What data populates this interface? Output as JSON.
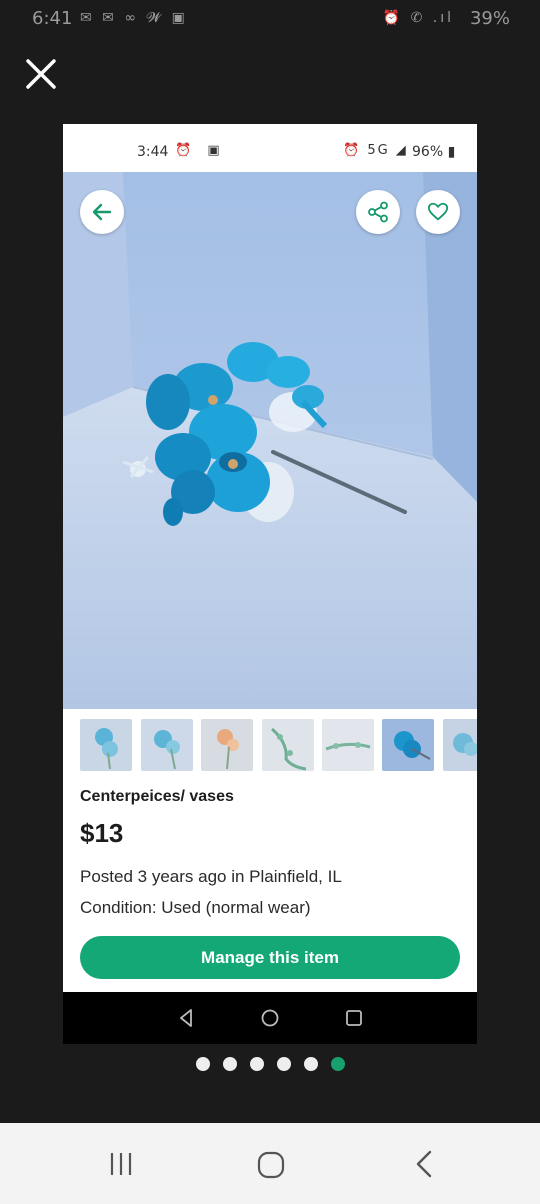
{
  "outer_status": {
    "time": "6:41",
    "left_icons": "✉ ✉ ∞ 𝓦 ▣",
    "right_icons": "⏰ ✆ .ıl",
    "battery": "39%"
  },
  "inner_status": {
    "time": "3:44",
    "left_icons": "⏰ ▣",
    "right_icons": "⏰ 5G ◢",
    "battery": "96% ▮"
  },
  "listing": {
    "title": "Centerpeices/ vases",
    "price": "$13",
    "posted": "Posted 3 years ago in Plainfield, IL",
    "condition": "Condition: Used (normal wear)",
    "manage_label": "Manage this item"
  },
  "thumbnails": [
    {
      "name": "thumb-1",
      "selected": false
    },
    {
      "name": "thumb-2",
      "selected": false
    },
    {
      "name": "thumb-3",
      "selected": false
    },
    {
      "name": "thumb-4",
      "selected": false
    },
    {
      "name": "thumb-5",
      "selected": false
    },
    {
      "name": "thumb-6",
      "selected": true
    },
    {
      "name": "thumb-7",
      "selected": false
    }
  ],
  "pager": {
    "count": 6,
    "active_index": 5
  },
  "colors": {
    "accent": "#14a876",
    "accent_icon": "#159a6c",
    "background": "#1b1b1b"
  },
  "icons": {
    "close": "close-icon",
    "back": "arrow-left-icon",
    "share": "share-icon",
    "favorite": "heart-icon",
    "nav_back": "triangle-back-icon",
    "nav_home": "circle-home-icon",
    "nav_recents": "square-recents-icon"
  }
}
